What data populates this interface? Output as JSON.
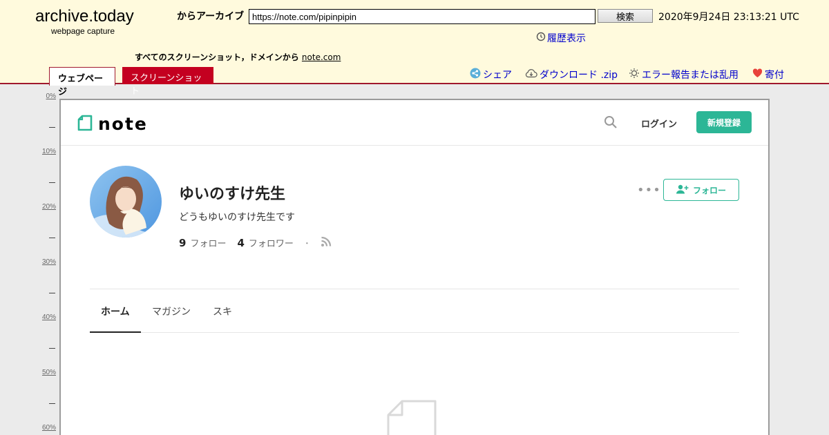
{
  "archive": {
    "title": "archive.today",
    "subtitle": "webpage capture",
    "archive_from_label": "からアーカイブ",
    "url_value": "https://note.com/pipinpipin",
    "search_label": "検索",
    "capture_date": "2020年9月24日 23:13:21 UTC",
    "history_label": "履歴表示",
    "all_screenshots_label": "すべてのスクリーンショット，ドメインから",
    "all_screenshots_domain": "note.com",
    "tabs": {
      "webpage": "ウェブページ",
      "screenshot": "スクリーンショット"
    },
    "actions": {
      "share": "シェア",
      "download": "ダウンロード .zip",
      "report": "エラー報告または乱用",
      "donate": "寄付"
    },
    "colors": {
      "header_bg": "#fffadd",
      "accent_red": "#c40020",
      "link_blue": "#0000cc"
    }
  },
  "ruler": {
    "labels": [
      "0%",
      "10%",
      "20%",
      "30%",
      "40%",
      "50%",
      "60%"
    ]
  },
  "note": {
    "logo_text": "note",
    "login_label": "ログイン",
    "signup_label": "新規登録",
    "profile": {
      "name": "ゆいのすけ先生",
      "bio": "どうもゆいのすけ先生です",
      "follow_count": "9",
      "follow_label": "フォロー",
      "follower_count": "4",
      "follower_label": "フォロワー",
      "follow_button_label": "フォロー"
    },
    "tabs": [
      "ホーム",
      "マガジン",
      "スキ"
    ],
    "colors": {
      "brand_green": "#2cb696"
    }
  }
}
